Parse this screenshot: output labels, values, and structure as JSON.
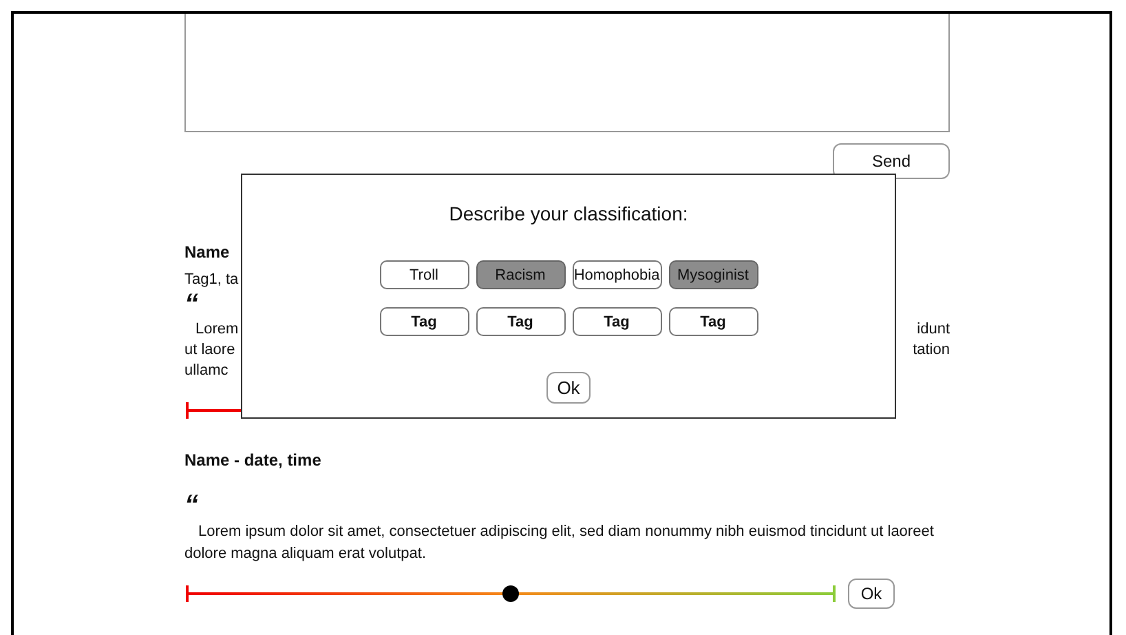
{
  "composer": {
    "send_label": "Send"
  },
  "comments": [
    {
      "kind": "covered",
      "name": "Name",
      "tags": "Tag1, ta",
      "quote_mark": "“",
      "lines": [
        {
          "left": "Lorem",
          "right": "idunt"
        },
        {
          "left": "ut laore",
          "right": "tation"
        },
        {
          "left": "ullamc"
        }
      ]
    },
    {
      "kind": "full",
      "name": "Name - date, time",
      "quote_mark": "“",
      "text": "Lorem ipsum dolor sit amet, consectetuer adipiscing elit, sed diam nonummy nibh euismod tincidunt ut laoreet dolore magna aliquam erat volutpat.",
      "level": 0.5,
      "ok_label": "Ok"
    }
  ],
  "dialog": {
    "title": "Describe your classification:",
    "categories": [
      {
        "label": "Troll",
        "selected": false
      },
      {
        "label": "Racism",
        "selected": true
      },
      {
        "label": "Homophobia",
        "selected": false
      },
      {
        "label": "Mysoginist",
        "selected": true
      }
    ],
    "tags": [
      {
        "label": "Tag",
        "selected": false
      },
      {
        "label": "Tag",
        "selected": false
      },
      {
        "label": "Tag",
        "selected": false
      },
      {
        "label": "Tag",
        "selected": false
      }
    ],
    "ok_label": "Ok"
  }
}
